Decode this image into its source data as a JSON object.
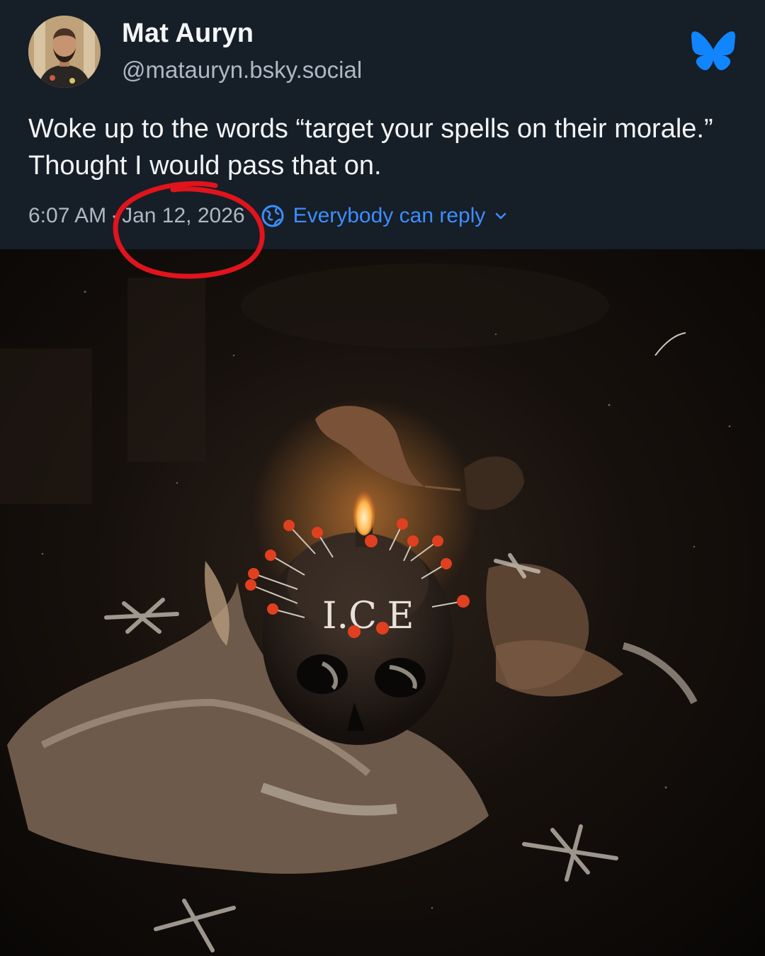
{
  "post": {
    "author": {
      "display_name": "Mat Auryn",
      "handle": "@matauryn.bsky.social",
      "avatar_icon": "person-avatar"
    },
    "text": "Woke up to the words “target your spells on their morale.” Thought I would pass that on.",
    "time": "6:07 AM",
    "separator": "·",
    "date": "Jan 12, 2026",
    "reply_setting": "Everybody can reply",
    "image": {
      "skull_text": "I.C.E"
    }
  },
  "icons": {
    "brand": "bluesky-butterfly-icon",
    "globe": "globe-icon",
    "chevron": "chevron-down-icon"
  },
  "colors": {
    "background": "#161e27",
    "accent": "#3c8eff",
    "annotation": "#e0141c",
    "secondary_text": "#aeb8c4"
  }
}
